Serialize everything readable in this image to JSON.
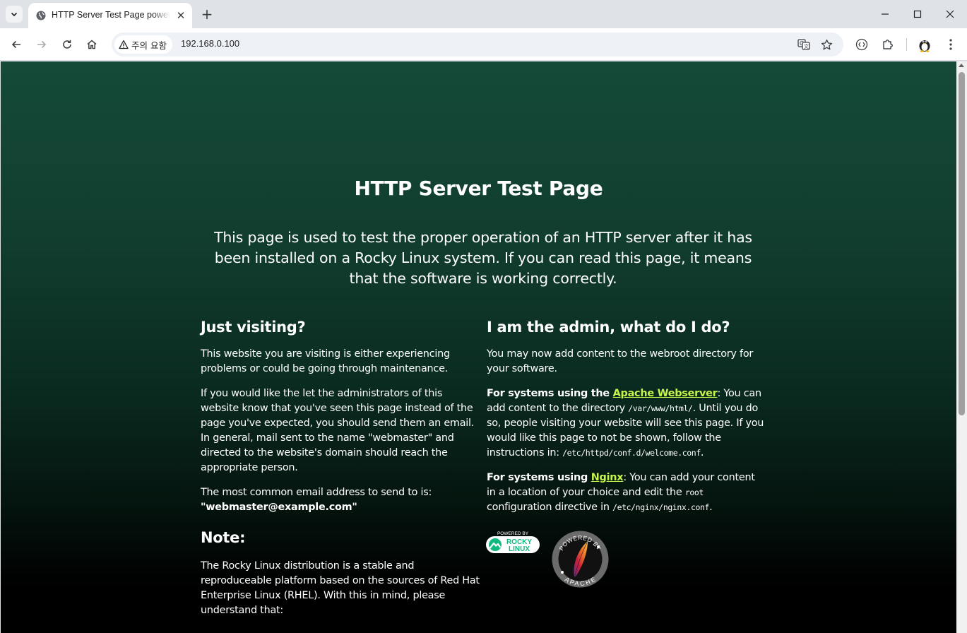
{
  "browser": {
    "tab": {
      "title": "HTTP Server Test Page powered by Rocky Linux"
    },
    "toolbar": {
      "security_label": "주의 요함",
      "url": "192.168.0.100"
    }
  },
  "page": {
    "title": "HTTP Server Test Page",
    "intro": "This page is used to test the proper operation of an HTTP server after it has been installed on a Rocky Linux system. If you can read this page, it means that the software is working correctly.",
    "left": {
      "heading": "Just visiting?",
      "p1": "This website you are visiting is either experiencing problems or could be going through maintenance.",
      "p2": "If you would like the let the administrators of this website know that you've seen this page instead of the page you've expected, you should send them an email. In general, mail sent to the name \"webmaster\" and directed to the website's domain should reach the appropriate person.",
      "p3_lead": "The most common email address to send to is:",
      "email": "\"webmaster@example.com\"",
      "note_heading": "Note:",
      "note_text": "The Rocky Linux distribution is a stable and reproduceable platform based on the sources of Red Hat Enterprise Linux (RHEL). With this in mind, please understand that:"
    },
    "right": {
      "heading": "I am the admin, what do I do?",
      "p1": "You may now add content to the webroot directory for your software.",
      "apache": {
        "lead": "For systems using the ",
        "link": "Apache Webserver",
        "text1": ": You can add content to the directory ",
        "path1": "/var/www/html/",
        "text2": ". Until you do so, people visiting your website will see this page. If you would like this page to not be shown, follow the instructions in: ",
        "path2": "/etc/httpd/conf.d/welcome.conf",
        "text3": "."
      },
      "nginx": {
        "lead": "For systems using ",
        "link": "Nginx",
        "text1": ": You can add your content in a location of your choice and edit the ",
        "code": "root",
        "text2": " configuration directive in ",
        "path": "/etc/nginx/nginx.conf",
        "text3": "."
      }
    },
    "badges": {
      "rocky_top": "POWERED BY",
      "rocky_line1": "ROCKY",
      "rocky_line2": "LINUX",
      "apache_top": "POWERED BY",
      "apache_bottom": "APACHE"
    }
  }
}
